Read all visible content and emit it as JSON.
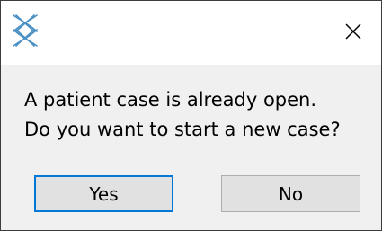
{
  "dialog": {
    "icon": "app-logo-icon",
    "close_icon": "close-icon",
    "message_line_1": "A patient case is already open.",
    "message_line_2": "Do you want to start a new case?",
    "buttons": {
      "yes_label": "Yes",
      "no_label": "No"
    },
    "colors": {
      "accent": "#0078d7",
      "content_bg": "#f0f0f0",
      "button_bg": "#e1e1e1",
      "icon_blue": "#4a90c4"
    }
  }
}
